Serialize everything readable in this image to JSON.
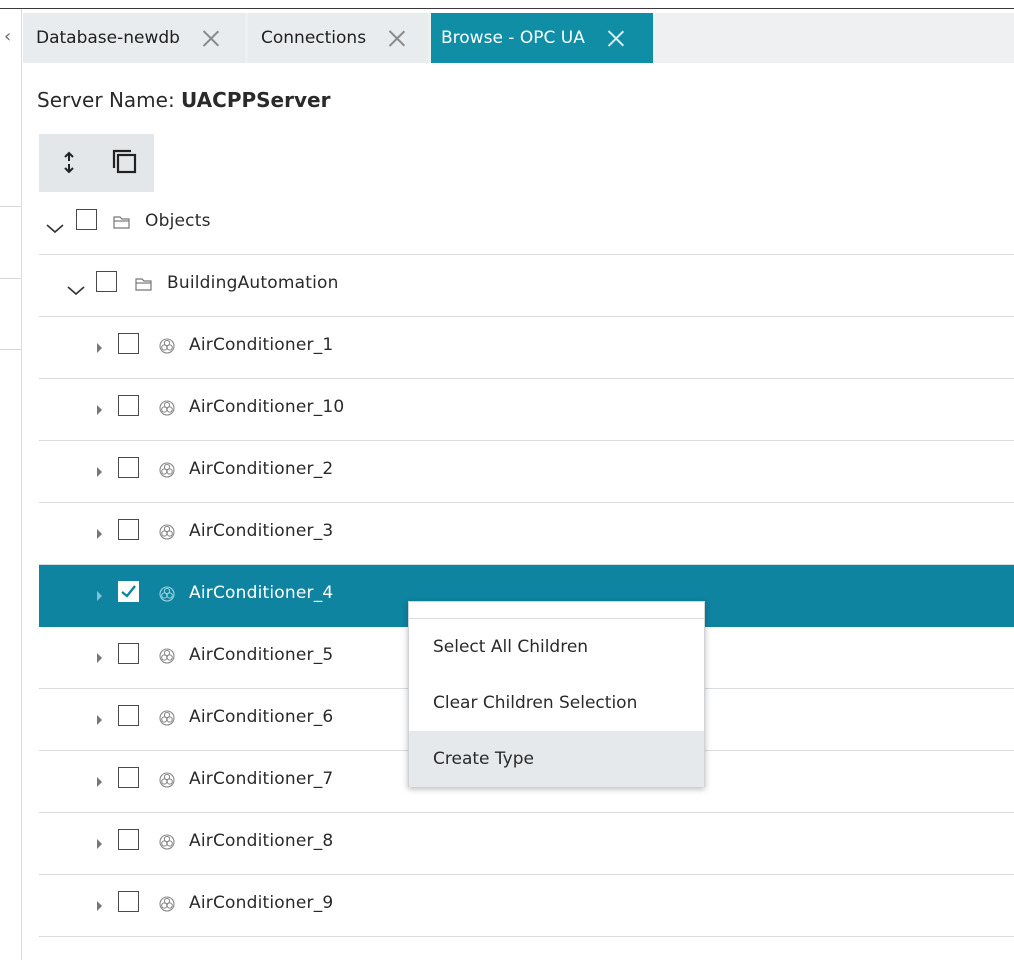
{
  "tabs": [
    {
      "label": "Database-newdb",
      "active": false
    },
    {
      "label": "Connections",
      "active": false
    },
    {
      "label": "Browse - OPC UA",
      "active": true
    }
  ],
  "server": {
    "label": "Server Name: ",
    "value": "UACPPServer"
  },
  "toolbar": {
    "expand_icon": "expand-collapse-icon",
    "copy_icon": "copy-icon"
  },
  "tree": {
    "root": {
      "label": "Objects",
      "expanded": true,
      "checked": false,
      "icon": "folder-icon"
    },
    "group": {
      "label": "BuildingAutomation",
      "expanded": true,
      "checked": false,
      "icon": "folder-icon"
    },
    "items": [
      {
        "label": "AirConditioner_1",
        "checked": false,
        "selected": false
      },
      {
        "label": "AirConditioner_10",
        "checked": false,
        "selected": false
      },
      {
        "label": "AirConditioner_2",
        "checked": false,
        "selected": false
      },
      {
        "label": "AirConditioner_3",
        "checked": false,
        "selected": false
      },
      {
        "label": "AirConditioner_4",
        "checked": true,
        "selected": true
      },
      {
        "label": "AirConditioner_5",
        "checked": false,
        "selected": false
      },
      {
        "label": "AirConditioner_6",
        "checked": false,
        "selected": false
      },
      {
        "label": "AirConditioner_7",
        "checked": false,
        "selected": false
      },
      {
        "label": "AirConditioner_8",
        "checked": false,
        "selected": false
      },
      {
        "label": "AirConditioner_9",
        "checked": false,
        "selected": false
      }
    ],
    "item_icon": "object-node-icon"
  },
  "context_menu": {
    "items": [
      {
        "label": "Select All Children",
        "hovered": false
      },
      {
        "label": "Clear Children Selection",
        "hovered": false
      },
      {
        "label": "Create Type",
        "hovered": true
      }
    ]
  },
  "colors": {
    "accent": "#0f8ea6",
    "selected_row": "#0e84a0",
    "tabbar_bg": "#eef0f1"
  }
}
